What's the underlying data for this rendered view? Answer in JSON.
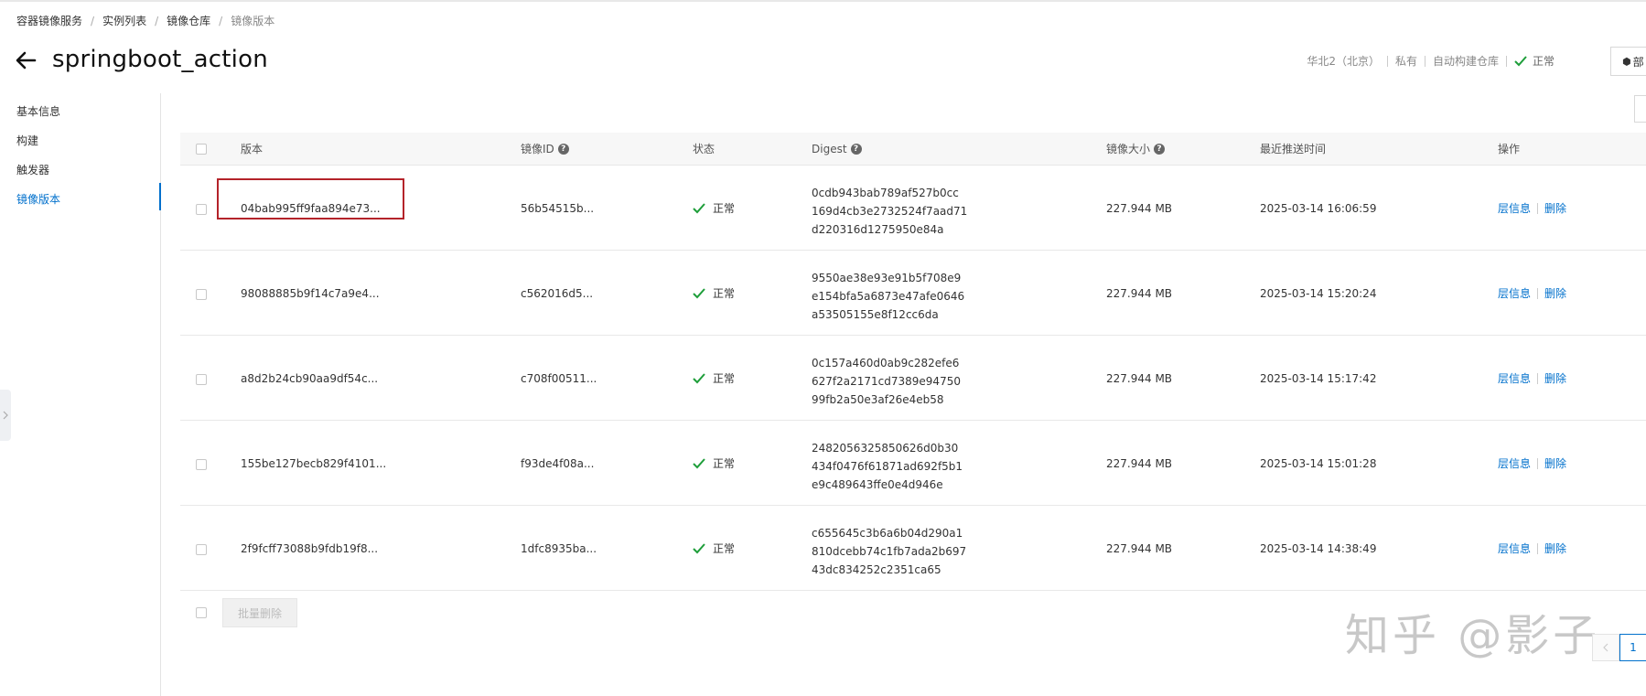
{
  "breadcrumb": [
    "容器镜像服务",
    "实例列表",
    "镜像仓库",
    "镜像版本"
  ],
  "title": "springboot_action",
  "meta": {
    "region": "华北2（北京）",
    "visibility": "私有",
    "type": "自动构建仓库",
    "status": "正常",
    "deploy_label": "部"
  },
  "sidebar": {
    "items": [
      {
        "label": "基本信息",
        "active": false
      },
      {
        "label": "构建",
        "active": false
      },
      {
        "label": "触发器",
        "active": false
      },
      {
        "label": "镜像版本",
        "active": true
      }
    ]
  },
  "table": {
    "columns": [
      "版本",
      "镜像ID",
      "状态",
      "Digest",
      "镜像大小",
      "最近推送时间",
      "操作"
    ],
    "rows": [
      {
        "version": "04bab995ff9faa894e73...",
        "image_id": "56b54515b...",
        "status": "正常",
        "digest": [
          "0cdb943bab789af527b0cc",
          "169d4cb3e2732524f7aad71",
          "d220316d1275950e84a"
        ],
        "size": "227.944 MB",
        "time": "2025-03-14 16:06:59"
      },
      {
        "version": "98088885b9f14c7a9e4...",
        "image_id": "c562016d5...",
        "status": "正常",
        "digest": [
          "9550ae38e93e91b5f708e9",
          "e154bfa5a6873e47afe0646",
          "a53505155e8f12cc6da"
        ],
        "size": "227.944 MB",
        "time": "2025-03-14 15:20:24"
      },
      {
        "version": "a8d2b24cb90aa9df54c...",
        "image_id": "c708f00511...",
        "status": "正常",
        "digest": [
          "0c157a460d0ab9c282efe6",
          "627f2a2171cd7389e94750",
          "99fb2a50e3af26e4eb58"
        ],
        "size": "227.944 MB",
        "time": "2025-03-14 15:17:42"
      },
      {
        "version": "155be127becb829f4101...",
        "image_id": "f93de4f08a...",
        "status": "正常",
        "digest": [
          "2482056325850626d0b30",
          "434f0476f61871ad692f5b1",
          "e9c489643ffe0e4d946e"
        ],
        "size": "227.944 MB",
        "time": "2025-03-14 15:01:28"
      },
      {
        "version": "2f9fcff73088b9fdb19f8...",
        "image_id": "1dfc8935ba...",
        "status": "正常",
        "digest": [
          "c655645c3b6a6b04d290a1",
          "810dcebb74c1fb7ada2b697",
          "43dc834252c2351ca65"
        ],
        "size": "227.944 MB",
        "time": "2025-03-14 14:38:49"
      }
    ],
    "ops": {
      "layers": "层信息",
      "delete": "删除"
    }
  },
  "batch_delete_label": "批量删除",
  "watermark": "知乎 @影子",
  "pagination": {
    "current": "1"
  },
  "colors": {
    "accent": "#0070cc",
    "success": "#1e9e3a",
    "highlight": "#b4232a"
  }
}
